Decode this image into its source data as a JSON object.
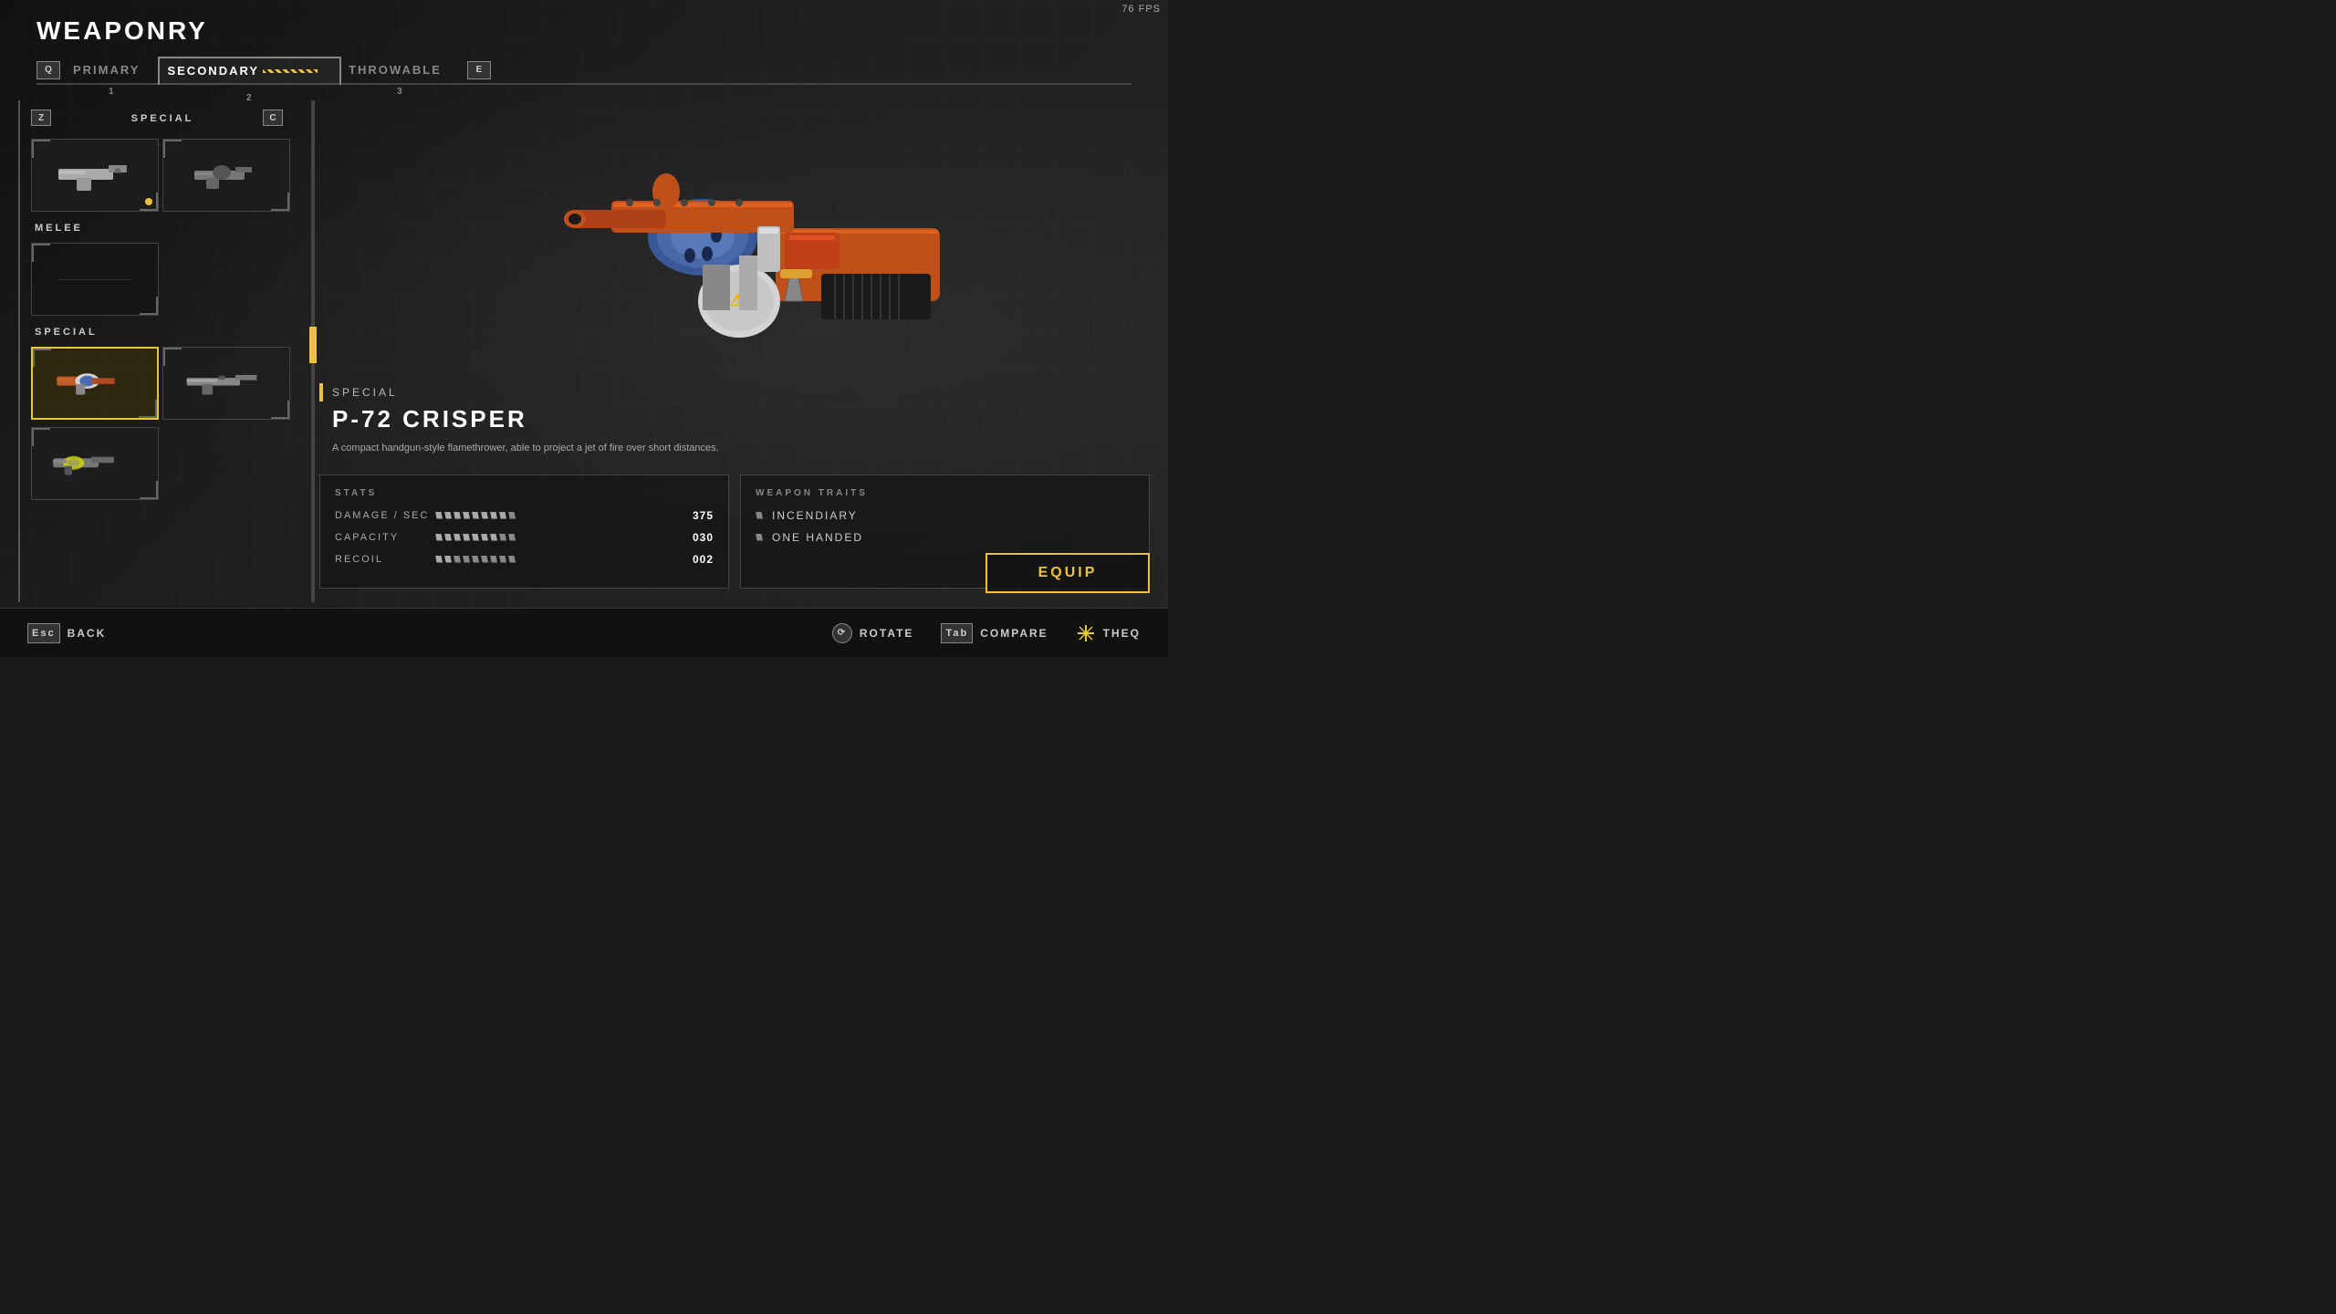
{
  "fps": "76 FPS",
  "header": {
    "title": "WEAPONRY",
    "tabs": [
      {
        "key": "Q",
        "label": "PRIMARY",
        "number": "1",
        "active": false
      },
      {
        "label": "SECONDARY",
        "number": "2",
        "active": true,
        "hatch": true
      },
      {
        "label": "THROWABLE",
        "number": "3",
        "active": false
      },
      {
        "key": "E",
        "label": "",
        "number": "",
        "active": false
      }
    ]
  },
  "left_panel": {
    "z_key": "Z",
    "c_key": "C",
    "special_label": "SPECIAL",
    "melee_label": "MELEE",
    "special_label2": "SPECIAL"
  },
  "weapon_detail": {
    "category": "SPECIAL",
    "name": "P-72 CRISPER",
    "description": "A compact handgun-style flamethrower, able to project a jet of fire over short distances.",
    "stats_title": "STATS",
    "stats": [
      {
        "label": "DAMAGE / SEC",
        "value": "375",
        "pips": 9,
        "filled": 8
      },
      {
        "label": "CAPACITY",
        "value": "030",
        "pips": 9,
        "filled": 7
      },
      {
        "label": "RECOIL",
        "value": "002",
        "pips": 9,
        "filled": 2
      }
    ],
    "traits_title": "WEAPON TRAITS",
    "traits": [
      {
        "label": "INCENDIARY"
      },
      {
        "label": "ONE HANDED"
      }
    ]
  },
  "buttons": {
    "equip": "EQUIP",
    "back": "BACK",
    "rotate": "ROTATE",
    "compare": "COMPARE",
    "theq": "THEQ"
  },
  "bottom": {
    "esc_key": "Esc",
    "tab_key": "Tab",
    "back_label": "BACK",
    "rotate_label": "ROTATE",
    "compare_label": "COMPARE"
  }
}
